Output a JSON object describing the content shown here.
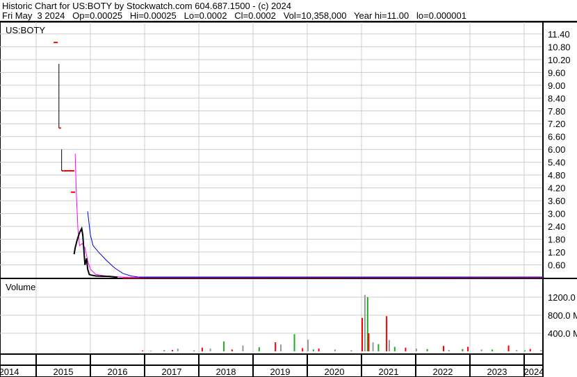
{
  "header": {
    "line1": "Historic Chart for US:BOTY by Stockwatch.com 604.687.1500 - (c) 2024",
    "line2": "Fri May  3 2024   Op=0.00025   Hi=0.00025   Lo=0.0002   Cl=0.0002   Vol=10,358,000   Year hi=11.00   lo=0.000001"
  },
  "chart_data": {
    "type": "line",
    "symbol": "US:BOTY",
    "volume_label": "Volume",
    "price_ticks": [
      "11.40",
      "10.80",
      "10.20",
      "9.60",
      "9.00",
      "8.40",
      "7.80",
      "7.20",
      "6.60",
      "6.00",
      "5.40",
      "4.80",
      "4.20",
      "3.60",
      "3.00",
      "2.40",
      "1.80",
      "1.20",
      "0.60"
    ],
    "price_tick_values": [
      11.4,
      10.8,
      10.2,
      9.6,
      9.0,
      8.4,
      7.8,
      7.2,
      6.6,
      6.0,
      5.4,
      4.8,
      4.2,
      3.6,
      3.0,
      2.4,
      1.8,
      1.2,
      0.6
    ],
    "volume_ticks": [
      "1200.0 M",
      "800.0 M",
      "400.0 M"
    ],
    "volume_tick_values": [
      1200,
      800,
      400
    ],
    "x_labels": [
      "2014",
      "2015",
      "2016",
      "2017",
      "2018",
      "2019",
      "2020",
      "2021",
      "2022",
      "2023",
      "2024"
    ],
    "xlim": [
      2014.33,
      2024.37
    ],
    "ylim": [
      0,
      12.2
    ],
    "price_bars": [
      [
        2015.36,
        11.0,
        11.0,
        "red"
      ],
      [
        2015.42,
        10.0,
        7.0,
        "black"
      ],
      [
        2015.47,
        6.0,
        5.0,
        "black"
      ],
      [
        2015.55,
        5.0,
        5.0,
        "red"
      ],
      [
        2015.68,
        4.0,
        4.0,
        "red"
      ]
    ],
    "close_series": {
      "name": "Price",
      "color": "#000000",
      "x": [
        2015.7,
        2015.72,
        2015.76,
        2015.8,
        2015.84,
        2015.86,
        2015.88,
        2015.9,
        2015.93,
        2015.95,
        2015.98,
        2016.02,
        2016.1,
        2016.2,
        2016.35,
        2016.5,
        2024.37
      ],
      "y": [
        1.1,
        1.4,
        1.8,
        2.1,
        2.3,
        2.0,
        1.3,
        0.6,
        0.9,
        0.4,
        0.15,
        0.12,
        0.08,
        0.07,
        0.06,
        0.02,
        0.0002
      ]
    },
    "ma_short": {
      "name": "Short MA",
      "color": "#ff00ff",
      "x": [
        2015.72,
        2015.74,
        2015.77,
        2015.8,
        2015.85,
        2015.9,
        2015.95,
        2016.0,
        2016.1,
        2016.3,
        2016.6,
        2016.9
      ],
      "y": [
        5.8,
        4.0,
        2.3,
        1.5,
        1.6,
        1.4,
        0.8,
        0.4,
        0.15,
        0.08,
        0.03,
        0.0
      ]
    },
    "ma_long": {
      "name": "Long MA",
      "color": "#0000cc",
      "x": [
        2015.95,
        2016.0,
        2016.05,
        2016.15,
        2016.3,
        2016.45,
        2016.6,
        2016.75,
        2016.95,
        2024.37
      ],
      "y": [
        3.1,
        2.0,
        1.5,
        1.2,
        0.8,
        0.45,
        0.2,
        0.08,
        0.01,
        0.0
      ]
    },
    "flat_line_color": "#ff0000",
    "volume_bars": [
      [
        2015.4,
        2
      ],
      [
        2016.95,
        20
      ],
      [
        2017.1,
        15
      ],
      [
        2017.35,
        25
      ],
      [
        2017.5,
        30
      ],
      [
        2017.6,
        60
      ],
      [
        2017.9,
        20
      ],
      [
        2018.05,
        80
      ],
      [
        2018.2,
        60
      ],
      [
        2018.45,
        220
      ],
      [
        2018.6,
        40
      ],
      [
        2018.8,
        130
      ],
      [
        2019.1,
        90
      ],
      [
        2019.4,
        200
      ],
      [
        2019.5,
        150
      ],
      [
        2019.75,
        380
      ],
      [
        2019.9,
        70
      ],
      [
        2020.0,
        260
      ],
      [
        2020.1,
        40
      ],
      [
        2020.2,
        60
      ],
      [
        2020.5,
        40
      ],
      [
        2020.8,
        20
      ],
      [
        2021.0,
        740
      ],
      [
        2021.05,
        1250
      ],
      [
        2021.1,
        1200
      ],
      [
        2021.12,
        400
      ],
      [
        2021.2,
        200
      ],
      [
        2021.3,
        160
      ],
      [
        2021.45,
        780
      ],
      [
        2021.5,
        250
      ],
      [
        2021.6,
        100
      ],
      [
        2021.8,
        80
      ],
      [
        2022.0,
        60
      ],
      [
        2022.2,
        50
      ],
      [
        2022.5,
        120
      ],
      [
        2022.6,
        30
      ],
      [
        2022.85,
        50
      ],
      [
        2022.95,
        100
      ],
      [
        2023.2,
        40
      ],
      [
        2023.4,
        40
      ],
      [
        2023.7,
        130
      ],
      [
        2023.85,
        30
      ],
      [
        2024.0,
        20
      ],
      [
        2024.1,
        50
      ],
      [
        2024.3,
        30
      ]
    ],
    "volume_colors": [
      "#22aa22",
      "#ff0000",
      "#999999"
    ]
  }
}
